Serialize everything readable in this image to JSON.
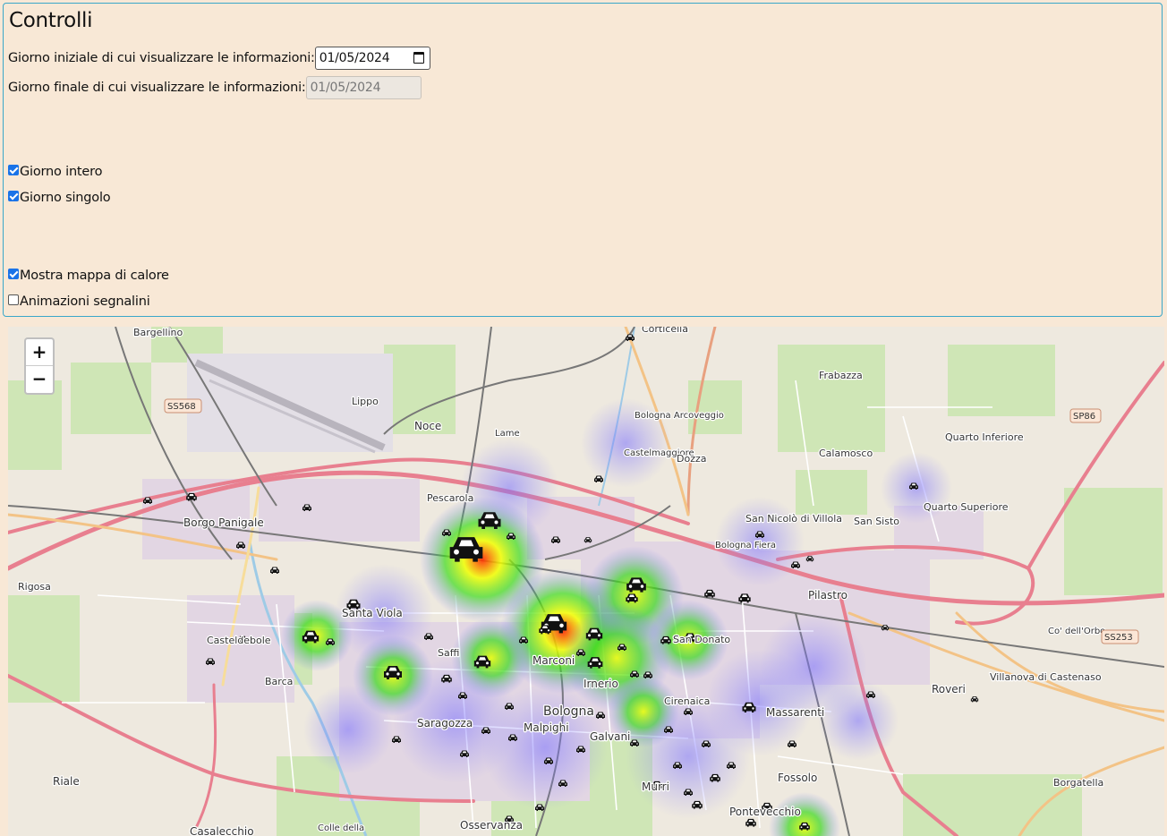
{
  "controls": {
    "title": "Controlli",
    "start_label": "Giorno iniziale di cui visualizzare le informazioni:",
    "start_value": "01/05/2024",
    "end_label": "Giorno finale di cui visualizzare le informazioni:",
    "end_value": "01/05/2024",
    "checkboxes": [
      {
        "label": "Giorno intero",
        "checked": true
      },
      {
        "label": "Giorno singolo",
        "checked": true
      },
      {
        "label": "Mostra mappa di calore",
        "checked": true
      },
      {
        "label": "Animazioni segnalini",
        "checked": false
      }
    ]
  },
  "map": {
    "zoom_in": "+",
    "zoom_out": "−",
    "places": [
      {
        "name": "Bargellino"
      },
      {
        "name": "Corticella"
      },
      {
        "name": "Frabazza"
      },
      {
        "name": "Lippo"
      },
      {
        "name": "Noce"
      },
      {
        "name": "Bologna Arcoveggio"
      },
      {
        "name": "Castelmaggiore"
      },
      {
        "name": "Dozza"
      },
      {
        "name": "Calamosco"
      },
      {
        "name": "Quarto Inferiore"
      },
      {
        "name": "Quarto Superiore"
      },
      {
        "name": "Borgo Panigale"
      },
      {
        "name": "Pescarola"
      },
      {
        "name": "San Nicolò di Villola"
      },
      {
        "name": "San Sisto"
      },
      {
        "name": "Rigosa"
      },
      {
        "name": "Pilastro"
      },
      {
        "name": "Casteldebole"
      },
      {
        "name": "Santa Viola"
      },
      {
        "name": "Saffi"
      },
      {
        "name": "Marconi"
      },
      {
        "name": "Irnerio"
      },
      {
        "name": "San Donato"
      },
      {
        "name": "Barca"
      },
      {
        "name": "Saragozza"
      },
      {
        "name": "Bologna"
      },
      {
        "name": "Malpighi"
      },
      {
        "name": "Galvani"
      },
      {
        "name": "Cirenaica"
      },
      {
        "name": "Massarenti"
      },
      {
        "name": "Roveri"
      },
      {
        "name": "Villanova di Castenaso"
      },
      {
        "name": "Fossolo"
      },
      {
        "name": "Murri"
      },
      {
        "name": "Pontevecchio"
      },
      {
        "name": "Osservanza"
      },
      {
        "name": "Riale"
      },
      {
        "name": "Casalecchio"
      },
      {
        "name": "Borgatella"
      },
      {
        "name": "Co' dell'Orbo"
      },
      {
        "name": "Colle della"
      },
      {
        "name": "Lame"
      },
      {
        "name": "Bologna Fiera"
      }
    ],
    "road_refs": [
      "SS568",
      "SP86",
      "SS253"
    ],
    "marker_icon": "car-icon"
  }
}
